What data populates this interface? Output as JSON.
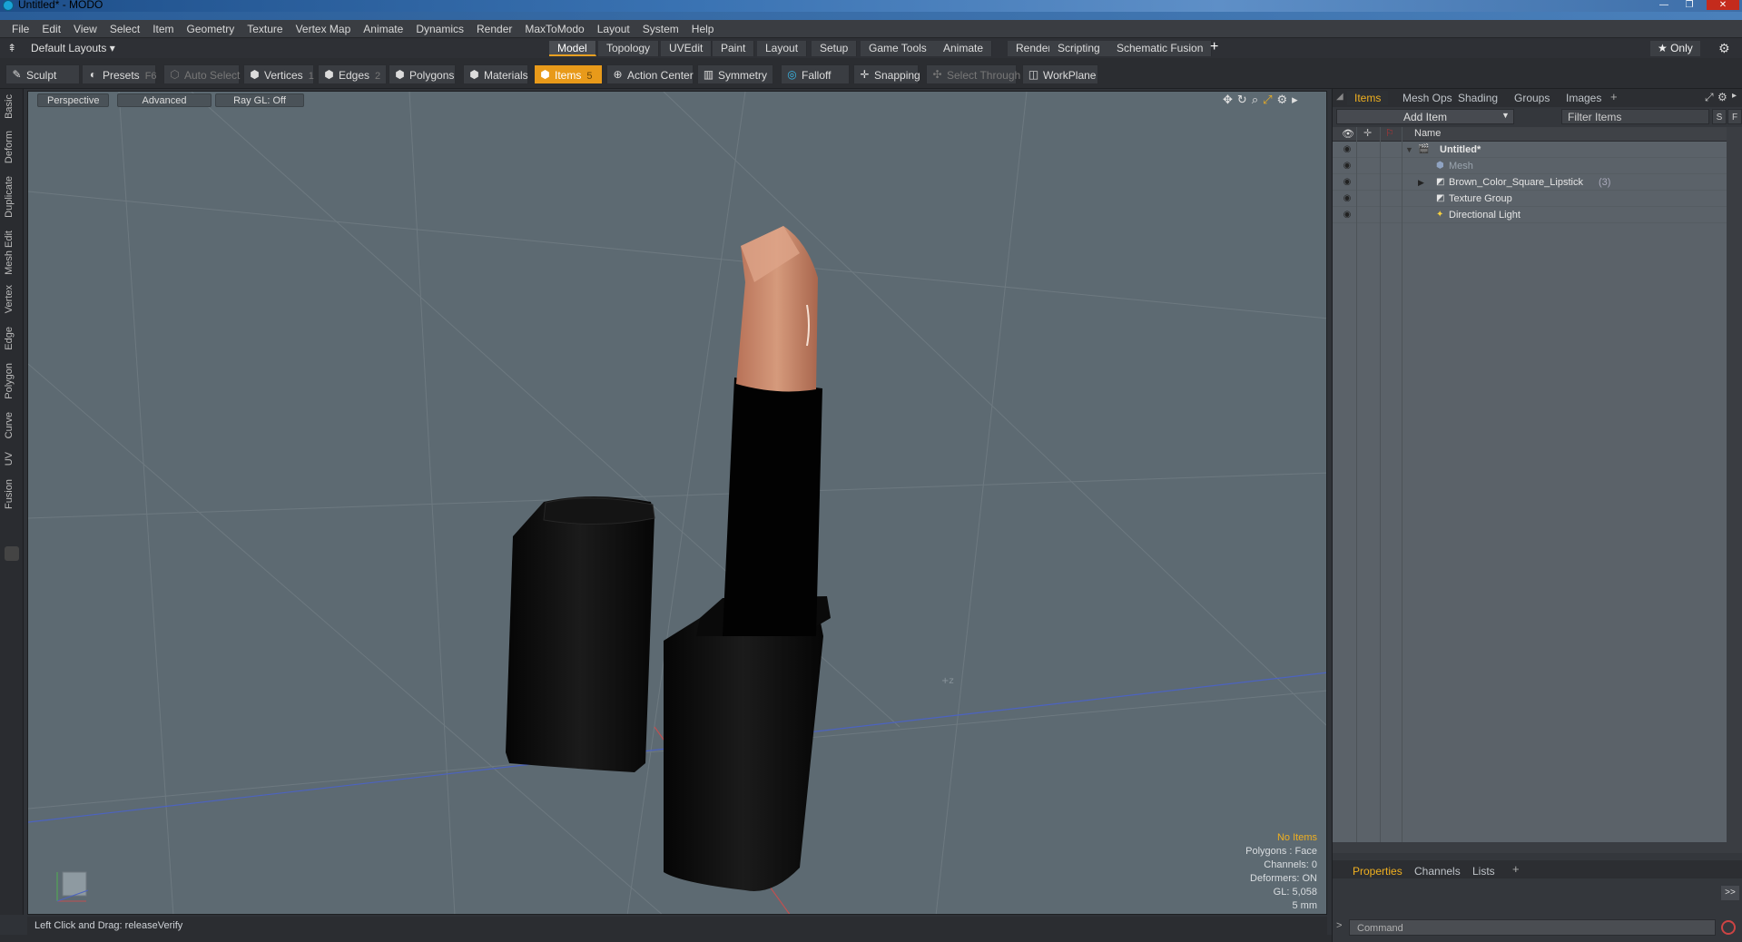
{
  "window": {
    "title": "Untitled* - MODO",
    "controls": [
      "—",
      "❐",
      "✕"
    ]
  },
  "menu": [
    "File",
    "Edit",
    "View",
    "Select",
    "Item",
    "Geometry",
    "Texture",
    "Vertex Map",
    "Animate",
    "Dynamics",
    "Render",
    "MaxToModo",
    "Layout",
    "System",
    "Help"
  ],
  "layouts": {
    "label": "Default Layouts ▾",
    "tabs": [
      "Model",
      "Topology",
      "UVEdit",
      "Paint",
      "Layout",
      "Setup",
      "Game Tools",
      "Animate",
      "Render",
      "Scripting",
      "Schematic Fusion"
    ],
    "active": "Model",
    "add": "+",
    "only": "★ Only"
  },
  "toolbar": {
    "sculpt": "Sculpt",
    "presets": "Presets",
    "presets_key": "F6",
    "auto_select": "Auto Select",
    "vertices": "Vertices",
    "vertices_key": "1",
    "edges": "Edges",
    "edges_key": "2",
    "polygons": "Polygons",
    "materials": "Materials",
    "items": "Items",
    "items_key": "5",
    "action_center": "Action Center",
    "symmetry": "Symmetry",
    "falloff": "Falloff",
    "snapping": "Snapping",
    "select_through": "Select Through",
    "workplane": "WorkPlane"
  },
  "left_tabs": [
    "Basic",
    "Deform",
    "Duplicate",
    "Mesh Edit",
    "Vertex",
    "Edge",
    "Polygon",
    "Curve",
    "UV",
    "Fusion"
  ],
  "viewport": {
    "view_mode": "Perspective",
    "shading": "Advanced",
    "ray_gl": "Ray GL: Off",
    "stats": {
      "selection": "No Items",
      "polygons": "Polygons : Face",
      "channels": "Channels: 0",
      "deformers": "Deformers: ON",
      "gl": "GL: 5,058",
      "unit": "5 mm"
    },
    "colors": {
      "background": "#5d6a72",
      "lipstick_tip": "#c9876a",
      "case": "#0d0d0d"
    }
  },
  "status_bar": {
    "hint": "Left Click and Drag:  releaseVerify"
  },
  "right_panel": {
    "tabs": [
      "Items",
      "Mesh Ops",
      "Shading",
      "Groups",
      "Images"
    ],
    "active_tab": "Items",
    "add": "+",
    "add_item": "Add Item",
    "filter_placeholder": "Filter Items",
    "s_btn": "S",
    "f_btn": "F",
    "col_name": "Name",
    "tree": [
      {
        "label": "Untitled*",
        "count": ""
      },
      {
        "label": "Mesh",
        "count": ""
      },
      {
        "label": "Brown_Color_Square_Lipstick",
        "count": "(3)"
      },
      {
        "label": "Texture Group",
        "count": ""
      },
      {
        "label": "Directional Light",
        "count": ""
      }
    ],
    "bottom_tabs": [
      "Properties",
      "Channels",
      "Lists"
    ],
    "bottom_active": "Properties",
    "expand": ">>",
    "command_placeholder": "Command"
  }
}
